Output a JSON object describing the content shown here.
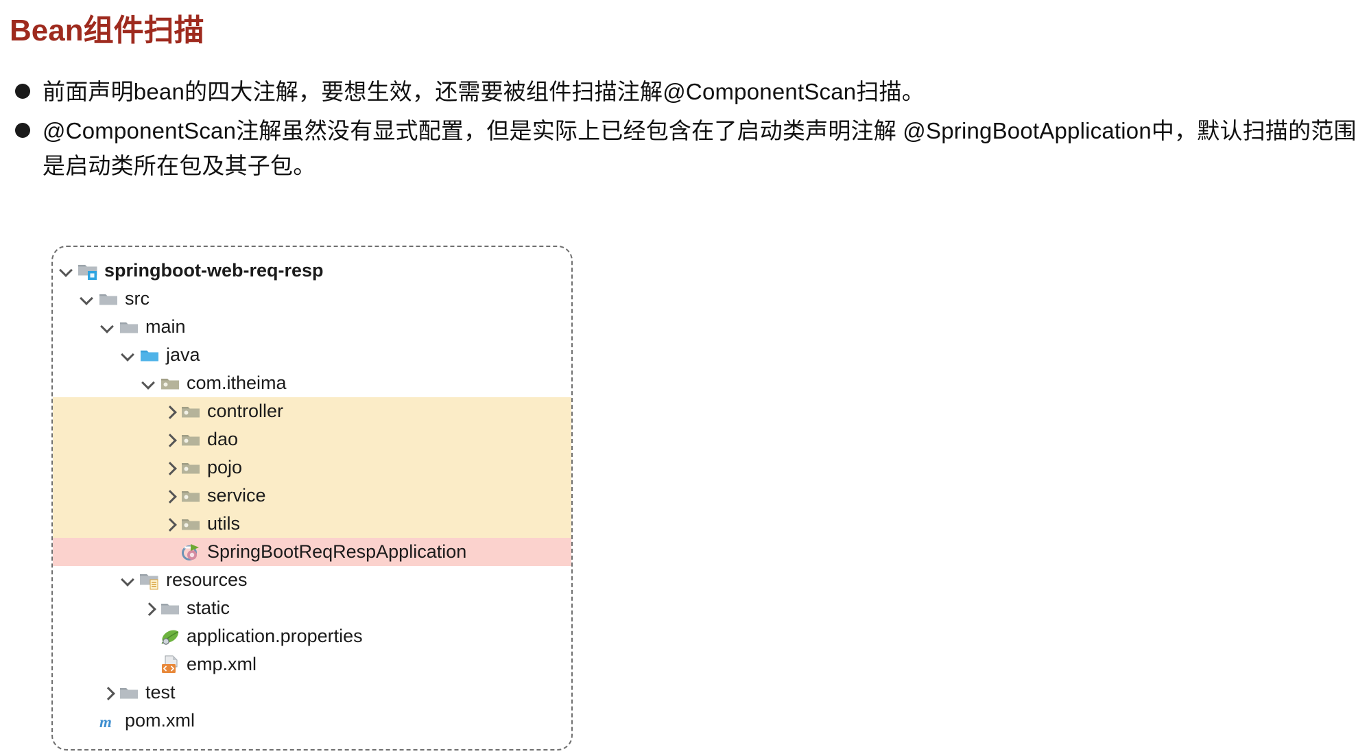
{
  "slide": {
    "title": "Bean组件扫描"
  },
  "bullets": [
    {
      "id": "bullet-1",
      "text": "前面声明bean的四大注解，要想生效，还需要被组件扫描注解@ComponentScan扫描。"
    },
    {
      "id": "bullet-2",
      "text": "@ComponentScan注解虽然没有显式配置，但是实际上已经包含在了启动类声明注解 @SpringBootApplication中，默认扫描的范围是启动类所在包及其子包。"
    }
  ],
  "colors": {
    "title": "#9e2a1e",
    "highlight_scan_range": "#fbecc7",
    "highlight_main_class": "#fbd2cd",
    "panel_border": "#6f6f6f",
    "source_root_folder": "#4fb3e8",
    "plain_folder": "#b6bcc2",
    "package_folder": "#b5b39a",
    "xml_icon": "#e8883a",
    "maven_icon": "#3f8fd0",
    "spring_leaf": "#6db33f"
  },
  "tree": {
    "nodes": [
      {
        "id": "node-root",
        "label": "springboot-web-req-resp",
        "indent": 0,
        "toggle": "down",
        "icon": "module-folder-icon",
        "bold": true,
        "highlight": "none"
      },
      {
        "id": "node-src",
        "label": "src",
        "indent": 1,
        "toggle": "down",
        "icon": "folder-icon",
        "bold": false,
        "highlight": "none"
      },
      {
        "id": "node-main",
        "label": "main",
        "indent": 2,
        "toggle": "down",
        "icon": "folder-icon",
        "bold": false,
        "highlight": "none"
      },
      {
        "id": "node-java",
        "label": "java",
        "indent": 3,
        "toggle": "down",
        "icon": "source-root-folder-icon",
        "bold": false,
        "highlight": "none"
      },
      {
        "id": "node-com-itheima",
        "label": "com.itheima",
        "indent": 4,
        "toggle": "down",
        "icon": "package-folder-icon",
        "bold": false,
        "highlight": "none"
      },
      {
        "id": "node-controller",
        "label": "controller",
        "indent": 5,
        "toggle": "right",
        "icon": "package-folder-icon",
        "bold": false,
        "highlight": "yellow"
      },
      {
        "id": "node-dao",
        "label": "dao",
        "indent": 5,
        "toggle": "right",
        "icon": "package-folder-icon",
        "bold": false,
        "highlight": "yellow"
      },
      {
        "id": "node-pojo",
        "label": "pojo",
        "indent": 5,
        "toggle": "right",
        "icon": "package-folder-icon",
        "bold": false,
        "highlight": "yellow"
      },
      {
        "id": "node-service",
        "label": "service",
        "indent": 5,
        "toggle": "right",
        "icon": "package-folder-icon",
        "bold": false,
        "highlight": "yellow"
      },
      {
        "id": "node-utils",
        "label": "utils",
        "indent": 5,
        "toggle": "right",
        "icon": "package-folder-icon",
        "bold": false,
        "highlight": "yellow"
      },
      {
        "id": "node-mainclass",
        "label": "SpringBootReqRespApplication",
        "indent": 5,
        "toggle": "none",
        "icon": "springboot-class-icon",
        "bold": false,
        "highlight": "pink"
      },
      {
        "id": "node-resources",
        "label": "resources",
        "indent": 3,
        "toggle": "down",
        "icon": "resources-folder-icon",
        "bold": false,
        "highlight": "none"
      },
      {
        "id": "node-static",
        "label": "static",
        "indent": 4,
        "toggle": "right",
        "icon": "folder-icon",
        "bold": false,
        "highlight": "none"
      },
      {
        "id": "node-appprops",
        "label": "application.properties",
        "indent": 4,
        "toggle": "none",
        "icon": "spring-leaf-icon",
        "bold": false,
        "highlight": "none"
      },
      {
        "id": "node-empxml",
        "label": "emp.xml",
        "indent": 4,
        "toggle": "none",
        "icon": "xml-file-icon",
        "bold": false,
        "highlight": "none"
      },
      {
        "id": "node-test",
        "label": "test",
        "indent": 2,
        "toggle": "right",
        "icon": "folder-icon",
        "bold": false,
        "highlight": "none"
      },
      {
        "id": "node-pomxml",
        "label": "pom.xml",
        "indent": 1,
        "toggle": "none",
        "icon": "maven-file-icon",
        "bold": false,
        "highlight": "none"
      }
    ]
  }
}
